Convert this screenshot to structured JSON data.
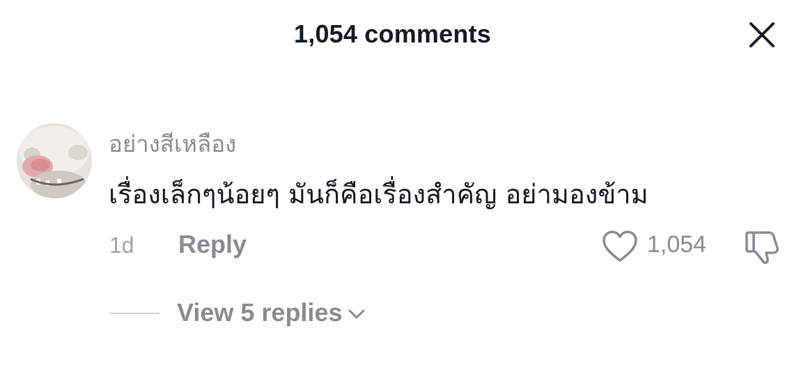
{
  "header": {
    "title": "1,054 comments",
    "close_icon": "close-icon"
  },
  "comment": {
    "avatar_icon": "avatar",
    "username": "อย่างสีเหลือง",
    "text": "เรื่องเล็กๆน้อยๆ มันก็คือเรื่องสำคัญ อย่ามองข้าม",
    "time": "1d",
    "reply_label": "Reply",
    "like_count": "1,054",
    "like_icon": "heart-icon",
    "dislike_icon": "thumbs-down-icon"
  },
  "replies": {
    "view_label": "View 5 replies",
    "chevron_icon": "chevron-down-icon"
  },
  "colors": {
    "text_primary": "#161823",
    "text_secondary": "#8a8b91",
    "divider": "#d3d4d6"
  }
}
